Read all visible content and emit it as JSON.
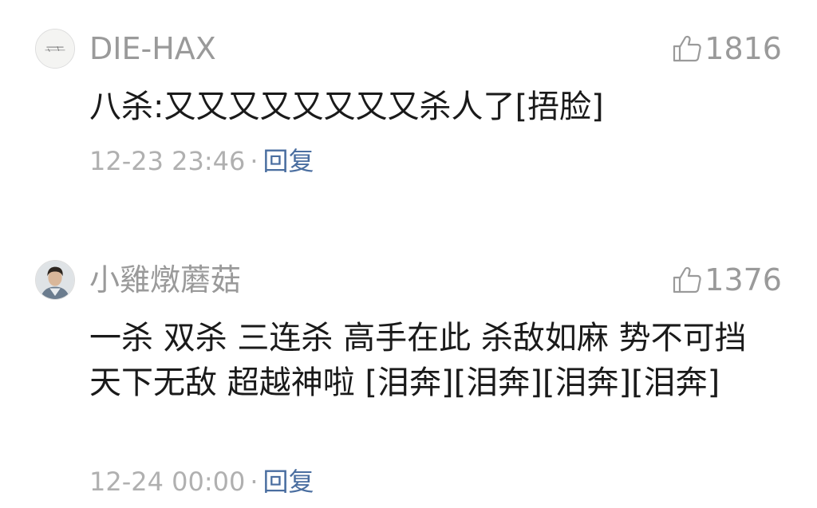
{
  "comments": [
    {
      "username": "DIE-HAX",
      "avatar_icon": "avatar-calligraphy-icon",
      "like_icon": "thumbs-up-icon",
      "likes": "1816",
      "text": "八杀:又又又又又又又又杀人了[捂脸]",
      "timestamp": "12-23 23:46",
      "separator": "·",
      "reply_label": "回复"
    },
    {
      "username": "小雞燉蘑菇",
      "avatar_icon": "avatar-person-icon",
      "like_icon": "thumbs-up-icon",
      "likes": "1376",
      "text": "一杀 双杀 三连杀 高手在此 杀敌如麻 势不可挡 天下无敌 超越神啦 [泪奔][泪奔][泪奔][泪奔]",
      "timestamp": "12-24 00:00",
      "separator": "·",
      "reply_label": "回复"
    }
  ],
  "colors": {
    "username": "#9a9a9a",
    "text": "#1a1a1a",
    "timestamp": "#b0b0b0",
    "reply_link": "#4a6ea0",
    "background": "#ffffff"
  }
}
